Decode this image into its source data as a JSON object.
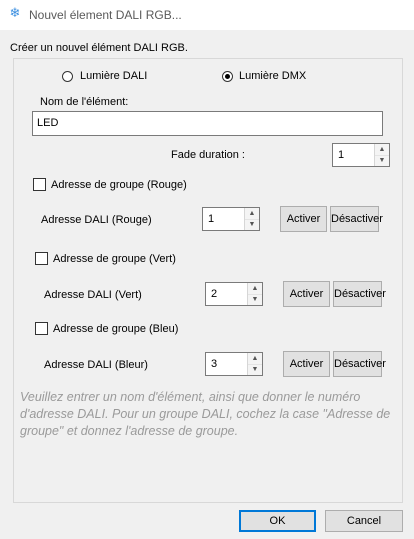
{
  "window": {
    "title": "Nouvel élement DALI RGB...",
    "icon": "snowflake-icon"
  },
  "intro": "Créer un nouvel élément DALI RGB.",
  "light_type": {
    "options": [
      "Lumière DALI",
      "Lumière DMX"
    ],
    "selected": "Lumière DMX"
  },
  "element_name": {
    "label": "Nom de l'élément:",
    "value": "LED"
  },
  "fade": {
    "label": "Fade duration :",
    "value": "1"
  },
  "groups": [
    {
      "checkbox_label": "Adresse de groupe (Rouge)",
      "checked": false,
      "address_label": "Adresse DALI (Rouge)",
      "value": "1",
      "activate": "Activer",
      "deactivate": "Désactiver"
    },
    {
      "checkbox_label": "Adresse de groupe (Vert)",
      "checked": false,
      "address_label": "Adresse DALI (Vert)",
      "value": "2",
      "activate": "Activer",
      "deactivate": "Désactiver"
    },
    {
      "checkbox_label": "Adresse de groupe (Bleu)",
      "checked": false,
      "address_label": "Adresse DALI (Bleur)",
      "value": "3",
      "activate": "Activer",
      "deactivate": "Désactiver"
    }
  ],
  "hint": "Veuillez entrer un nom d'élément, ainsi que donner le numéro d'adresse DALI. Pour un groupe DALI, cochez la case \"Adresse de groupe\" et donnez l'adresse de groupe.",
  "buttons": {
    "ok": "OK",
    "cancel": "Cancel"
  }
}
